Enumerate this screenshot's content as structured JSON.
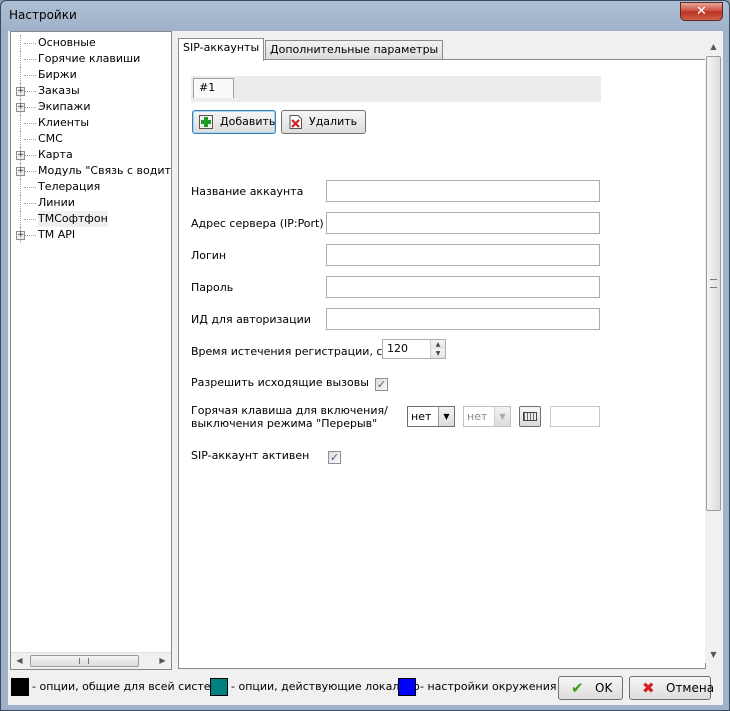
{
  "window": {
    "title": "Настройки",
    "close_glyph": "✕"
  },
  "tree": {
    "items": [
      {
        "label": "Основные",
        "expandable": false
      },
      {
        "label": "Горячие клавиши",
        "expandable": false
      },
      {
        "label": "Биржи",
        "expandable": false
      },
      {
        "label": "Заказы",
        "expandable": true
      },
      {
        "label": "Экипажи",
        "expandable": true
      },
      {
        "label": "Клиенты",
        "expandable": false
      },
      {
        "label": "СМС",
        "expandable": false
      },
      {
        "label": "Карта",
        "expandable": true
      },
      {
        "label": "Модуль \"Связь с водителем\"",
        "expandable": true
      },
      {
        "label": "Телерация",
        "expandable": false
      },
      {
        "label": "Линии",
        "expandable": false
      },
      {
        "label": "ТМСофтфон",
        "expandable": false,
        "selected": true
      },
      {
        "label": "TM API",
        "expandable": true
      }
    ]
  },
  "tabs": [
    {
      "label": "SIP-аккаунты",
      "active": true
    },
    {
      "label": "Дополнительные параметры",
      "active": false
    }
  ],
  "account": {
    "tab_label": "#1",
    "add_label": "Добавить",
    "delete_label": "Удалить"
  },
  "fields": {
    "account_name": {
      "label": "Название аккаунта",
      "value": ""
    },
    "server_address": {
      "label": "Адрес сервера (IP:Port)",
      "value": ""
    },
    "login": {
      "label": "Логин",
      "value": ""
    },
    "password": {
      "label": "Пароль",
      "value": ""
    },
    "auth_id": {
      "label": "ИД для авторизации",
      "value": ""
    }
  },
  "registration": {
    "label": "Время истечения регистрации, сек",
    "value": "120"
  },
  "allow_outgoing": {
    "label": "Разрешить исходящие вызовы",
    "checked": true,
    "glyph": "✓"
  },
  "break_hotkey": {
    "label_line1": "Горячая клавиша для  включения/",
    "label_line2": "выключения режима \"Перерыв\"",
    "modifier1": "нет",
    "modifier2": "нет",
    "key": ""
  },
  "sip_active": {
    "label": "SIP-аккаунт активен",
    "checked": true,
    "glyph": "✓"
  },
  "legend": {
    "global": {
      "text": "- опции, общие для всей системы",
      "color": "#000000"
    },
    "local": {
      "text": "- опции, действующие локально",
      "color": "#008080"
    },
    "environment": {
      "text": "- настройки окружения",
      "color": "#0000ff"
    }
  },
  "buttons": {
    "ok": "OK",
    "cancel": "Отмена"
  }
}
